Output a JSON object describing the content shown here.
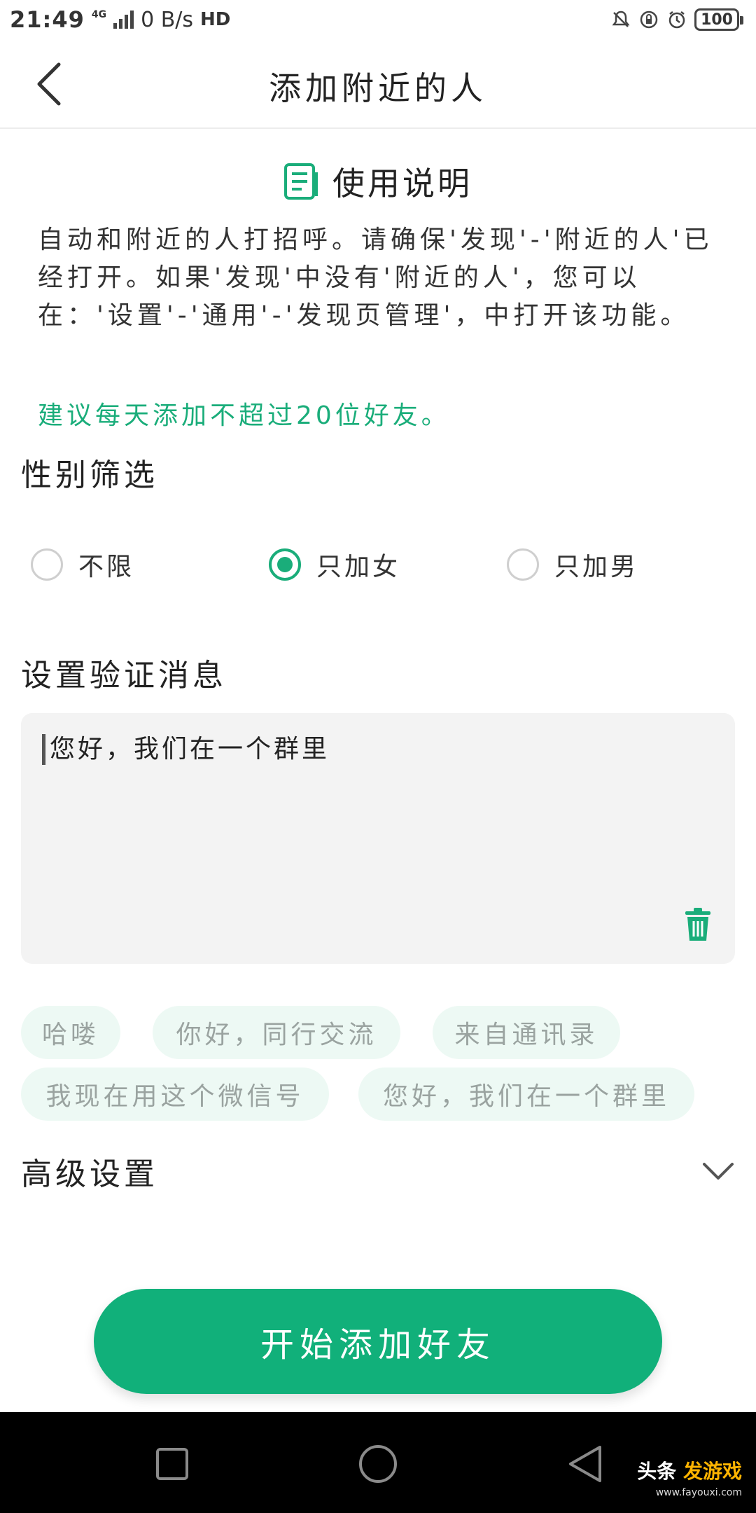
{
  "status_bar": {
    "time": "21:49",
    "network_type": "4G",
    "speed": "0 B/s",
    "hd_label": "HD",
    "battery": "100"
  },
  "header": {
    "title": "添加附近的人"
  },
  "usage": {
    "title": "使用说明",
    "description": "自动和附近的人打招呼。请确保'发现'-'附近的人'已经打开。如果'发现'中没有'附近的人'，您可以在：'设置'-'通用'-'发现页管理'，中打开该功能。",
    "tip": "建议每天添加不超过20位好友。"
  },
  "gender_filter": {
    "title": "性别筛选",
    "options": [
      {
        "label": "不限",
        "checked": false
      },
      {
        "label": "只加女",
        "checked": true
      },
      {
        "label": "只加男",
        "checked": false
      }
    ]
  },
  "verify_message": {
    "title": "设置验证消息",
    "value": "您好，我们在一个群里",
    "presets": [
      "哈喽",
      "你好，同行交流",
      "来自通讯录",
      "我现在用这个微信号",
      "您好，我们在一个群里"
    ]
  },
  "advanced": {
    "title": "高级设置"
  },
  "start_button": {
    "label": "开始添加好友"
  },
  "watermark": {
    "prefix": "头条",
    "brand": "发游戏",
    "site": "www.fayouxi.com"
  },
  "colors": {
    "accent": "#1aad7a",
    "button": "#11b07a",
    "chip_bg": "#edf9f4",
    "input_bg": "#f3f3f3"
  }
}
